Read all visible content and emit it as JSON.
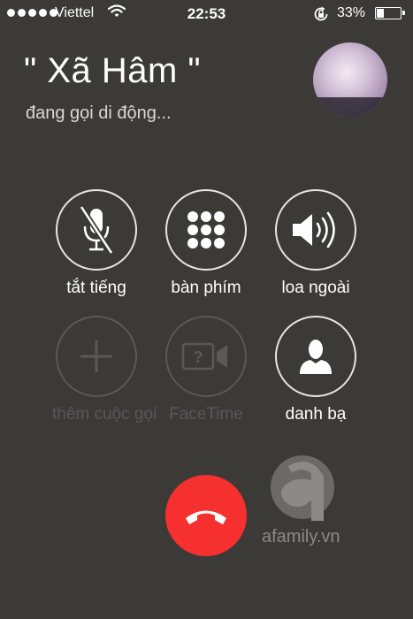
{
  "status_bar": {
    "carrier": "Viettel",
    "time": "22:53",
    "battery_percent": "33%",
    "battery_level": 0.33,
    "signal_bars": 5
  },
  "call": {
    "caller_name": "\" Xã Hâm \"",
    "status": "đang gọi di động..."
  },
  "controls": [
    {
      "label": "tắt tiếng",
      "icon": "mute-microphone-icon",
      "enabled": true
    },
    {
      "label": "bàn phím",
      "icon": "keypad-icon",
      "enabled": true
    },
    {
      "label": "loa ngoài",
      "icon": "speaker-icon",
      "enabled": true
    },
    {
      "label": "thêm cuộc gọi",
      "icon": "plus-icon",
      "enabled": false
    },
    {
      "label": "FaceTime",
      "icon": "facetime-icon",
      "enabled": false
    },
    {
      "label": "danh bạ",
      "icon": "contacts-icon",
      "enabled": true
    }
  ],
  "end_call": {
    "icon": "end-call-icon",
    "color": "#f5302e"
  },
  "watermark": {
    "text": "afamily.vn"
  },
  "colors": {
    "background": "#3b3a37",
    "end_call": "#f5302e",
    "disabled": "#58575a"
  }
}
